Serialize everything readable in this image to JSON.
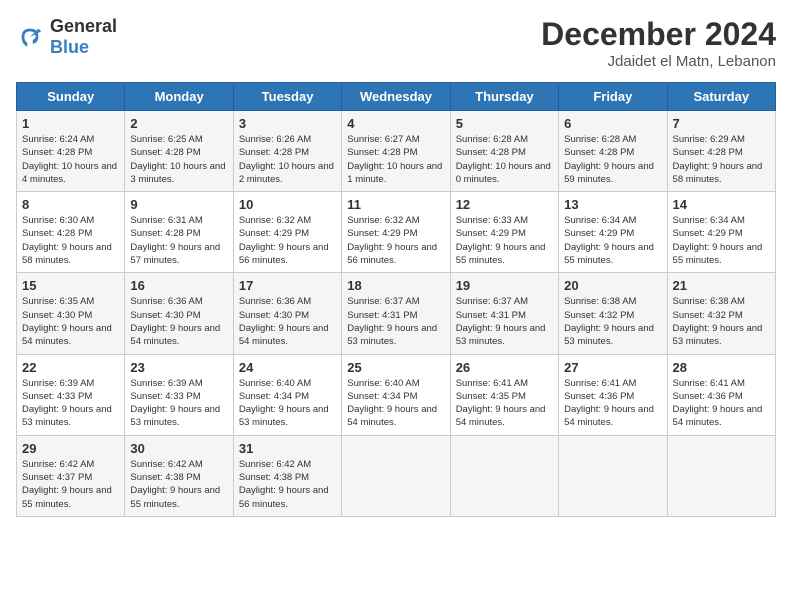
{
  "header": {
    "logo_general": "General",
    "logo_blue": "Blue",
    "title": "December 2024",
    "subtitle": "Jdaidet el Matn, Lebanon"
  },
  "calendar": {
    "days_of_week": [
      "Sunday",
      "Monday",
      "Tuesday",
      "Wednesday",
      "Thursday",
      "Friday",
      "Saturday"
    ],
    "weeks": [
      [
        {
          "day": "1",
          "sunrise": "6:24 AM",
          "sunset": "4:28 PM",
          "daylight": "10 hours and 4 minutes."
        },
        {
          "day": "2",
          "sunrise": "6:25 AM",
          "sunset": "4:28 PM",
          "daylight": "10 hours and 3 minutes."
        },
        {
          "day": "3",
          "sunrise": "6:26 AM",
          "sunset": "4:28 PM",
          "daylight": "10 hours and 2 minutes."
        },
        {
          "day": "4",
          "sunrise": "6:27 AM",
          "sunset": "4:28 PM",
          "daylight": "10 hours and 1 minute."
        },
        {
          "day": "5",
          "sunrise": "6:28 AM",
          "sunset": "4:28 PM",
          "daylight": "10 hours and 0 minutes."
        },
        {
          "day": "6",
          "sunrise": "6:28 AM",
          "sunset": "4:28 PM",
          "daylight": "9 hours and 59 minutes."
        },
        {
          "day": "7",
          "sunrise": "6:29 AM",
          "sunset": "4:28 PM",
          "daylight": "9 hours and 58 minutes."
        }
      ],
      [
        {
          "day": "8",
          "sunrise": "6:30 AM",
          "sunset": "4:28 PM",
          "daylight": "9 hours and 58 minutes."
        },
        {
          "day": "9",
          "sunrise": "6:31 AM",
          "sunset": "4:28 PM",
          "daylight": "9 hours and 57 minutes."
        },
        {
          "day": "10",
          "sunrise": "6:32 AM",
          "sunset": "4:29 PM",
          "daylight": "9 hours and 56 minutes."
        },
        {
          "day": "11",
          "sunrise": "6:32 AM",
          "sunset": "4:29 PM",
          "daylight": "9 hours and 56 minutes."
        },
        {
          "day": "12",
          "sunrise": "6:33 AM",
          "sunset": "4:29 PM",
          "daylight": "9 hours and 55 minutes."
        },
        {
          "day": "13",
          "sunrise": "6:34 AM",
          "sunset": "4:29 PM",
          "daylight": "9 hours and 55 minutes."
        },
        {
          "day": "14",
          "sunrise": "6:34 AM",
          "sunset": "4:29 PM",
          "daylight": "9 hours and 55 minutes."
        }
      ],
      [
        {
          "day": "15",
          "sunrise": "6:35 AM",
          "sunset": "4:30 PM",
          "daylight": "9 hours and 54 minutes."
        },
        {
          "day": "16",
          "sunrise": "6:36 AM",
          "sunset": "4:30 PM",
          "daylight": "9 hours and 54 minutes."
        },
        {
          "day": "17",
          "sunrise": "6:36 AM",
          "sunset": "4:30 PM",
          "daylight": "9 hours and 54 minutes."
        },
        {
          "day": "18",
          "sunrise": "6:37 AM",
          "sunset": "4:31 PM",
          "daylight": "9 hours and 53 minutes."
        },
        {
          "day": "19",
          "sunrise": "6:37 AM",
          "sunset": "4:31 PM",
          "daylight": "9 hours and 53 minutes."
        },
        {
          "day": "20",
          "sunrise": "6:38 AM",
          "sunset": "4:32 PM",
          "daylight": "9 hours and 53 minutes."
        },
        {
          "day": "21",
          "sunrise": "6:38 AM",
          "sunset": "4:32 PM",
          "daylight": "9 hours and 53 minutes."
        }
      ],
      [
        {
          "day": "22",
          "sunrise": "6:39 AM",
          "sunset": "4:33 PM",
          "daylight": "9 hours and 53 minutes."
        },
        {
          "day": "23",
          "sunrise": "6:39 AM",
          "sunset": "4:33 PM",
          "daylight": "9 hours and 53 minutes."
        },
        {
          "day": "24",
          "sunrise": "6:40 AM",
          "sunset": "4:34 PM",
          "daylight": "9 hours and 53 minutes."
        },
        {
          "day": "25",
          "sunrise": "6:40 AM",
          "sunset": "4:34 PM",
          "daylight": "9 hours and 54 minutes."
        },
        {
          "day": "26",
          "sunrise": "6:41 AM",
          "sunset": "4:35 PM",
          "daylight": "9 hours and 54 minutes."
        },
        {
          "day": "27",
          "sunrise": "6:41 AM",
          "sunset": "4:36 PM",
          "daylight": "9 hours and 54 minutes."
        },
        {
          "day": "28",
          "sunrise": "6:41 AM",
          "sunset": "4:36 PM",
          "daylight": "9 hours and 54 minutes."
        }
      ],
      [
        {
          "day": "29",
          "sunrise": "6:42 AM",
          "sunset": "4:37 PM",
          "daylight": "9 hours and 55 minutes."
        },
        {
          "day": "30",
          "sunrise": "6:42 AM",
          "sunset": "4:38 PM",
          "daylight": "9 hours and 55 minutes."
        },
        {
          "day": "31",
          "sunrise": "6:42 AM",
          "sunset": "4:38 PM",
          "daylight": "9 hours and 56 minutes."
        },
        null,
        null,
        null,
        null
      ]
    ]
  }
}
